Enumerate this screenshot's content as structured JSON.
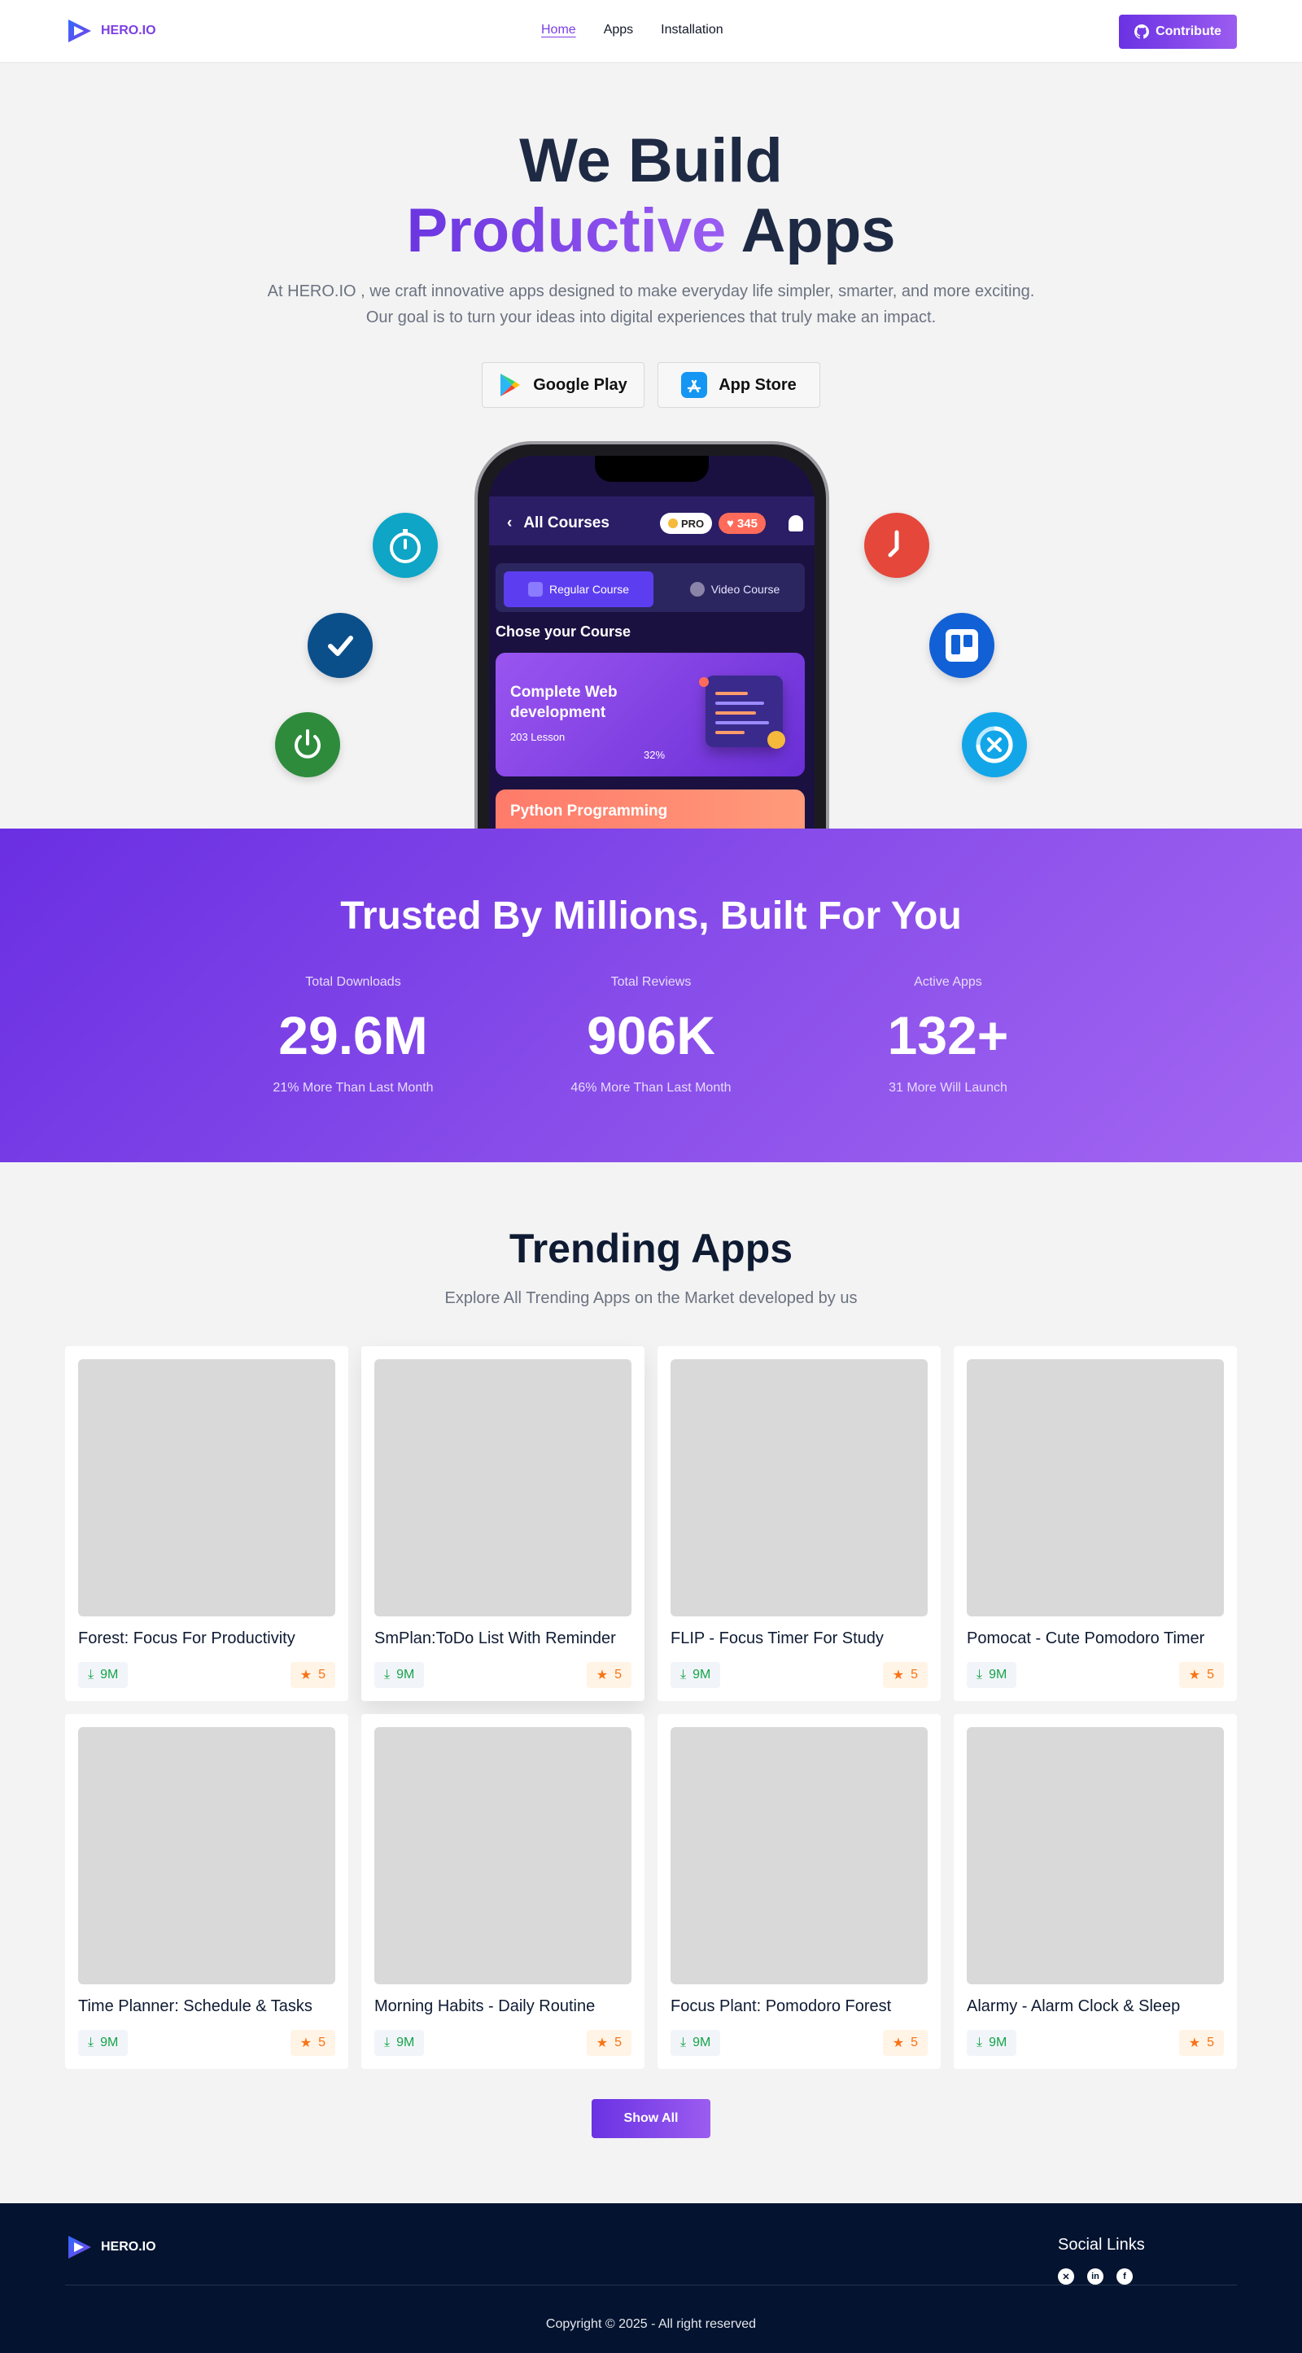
{
  "nav": {
    "brand": "HERO.IO",
    "links": [
      "Home",
      "Apps",
      "Installation"
    ],
    "contribute_label": "Contribute"
  },
  "hero": {
    "title_line1": "We Build",
    "title_highlight": "Productive",
    "title_rest": "Apps",
    "subtitle_line1": "At HERO.IO , we craft innovative apps designed to make everyday life simpler, smarter, and more exciting.",
    "subtitle_line2": "Our goal is to turn your ideas into digital experiences that truly make an impact.",
    "google_play_label": "Google Play",
    "app_store_label": "App Store"
  },
  "phone": {
    "header_title": "All Courses",
    "pro_label": "PRO",
    "points": "345",
    "tab_regular": "Regular Course",
    "tab_video": "Video Course",
    "choose_label": "Chose your Course",
    "course1_title": "Complete Web development",
    "course1_lessons": "203 Lesson",
    "course1_progress": "32%",
    "course2_title": "Python Programming"
  },
  "stats": {
    "title": "Trusted By Millions, Built For You",
    "items": [
      {
        "label": "Total Downloads",
        "value": "29.6M",
        "sub": "21% More Than Last Month"
      },
      {
        "label": "Total Reviews",
        "value": "906K",
        "sub": "46% More Than Last Month"
      },
      {
        "label": "Active Apps",
        "value": "132+",
        "sub": "31 More Will Launch"
      }
    ]
  },
  "trending": {
    "title": "Trending Apps",
    "subtitle": "Explore All Trending Apps on the Market developed by us",
    "apps": [
      {
        "name": "Forest: Focus For Productivity",
        "downloads": "9M",
        "rating": "5"
      },
      {
        "name": "SmPlan:ToDo List With Reminder",
        "downloads": "9M",
        "rating": "5"
      },
      {
        "name": "FLIP - Focus Timer For Study",
        "downloads": "9M",
        "rating": "5"
      },
      {
        "name": "Pomocat - Cute Pomodoro Timer",
        "downloads": "9M",
        "rating": "5"
      },
      {
        "name": "Time Planner: Schedule & Tasks",
        "downloads": "9M",
        "rating": "5"
      },
      {
        "name": "Morning Habits - Daily Routine",
        "downloads": "9M",
        "rating": "5"
      },
      {
        "name": "Focus Plant: Pomodoro Forest",
        "downloads": "9M",
        "rating": "5"
      },
      {
        "name": "Alarmy - Alarm Clock & Sleep",
        "downloads": "9M",
        "rating": "5"
      }
    ],
    "show_all_label": "Show All"
  },
  "footer": {
    "brand": "HERO.IO",
    "social_title": "Social Links",
    "social_icons": [
      "x-icon",
      "linkedin-icon",
      "facebook-icon"
    ],
    "copyright": "Copyright © 2025 - All right reserved"
  },
  "colors": {
    "accent": "#7b3fe4",
    "accent_light": "#9b5cf0",
    "footer_bg": "#031330",
    "download_green": "#16a34a",
    "rating_orange": "#f97316"
  }
}
